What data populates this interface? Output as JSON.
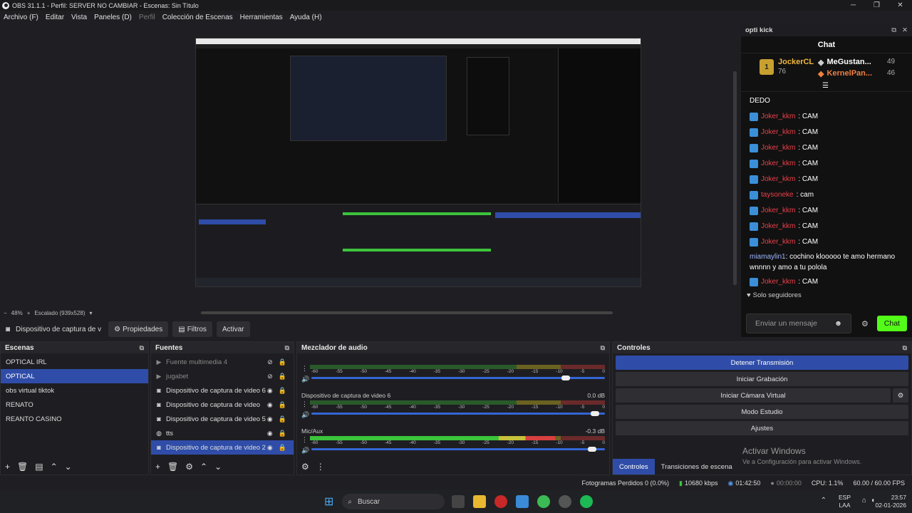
{
  "window": {
    "title": "OBS 31.1.1 - Perfil: SERVER NO CAMBIAR - Escenas: Sin Título",
    "minimize": "─",
    "maximize": "❐",
    "close": "✕"
  },
  "menu": [
    "Archivo (F)",
    "Editar",
    "Vista",
    "Paneles (D)",
    "Perfil",
    "Colección de Escenas",
    "Herramientas",
    "Ayuda (H)"
  ],
  "zoom": {
    "minus": "−",
    "value": "48%",
    "plus": "+",
    "scale": "Escalado (939x528)"
  },
  "source_toolbar": {
    "source_name": "Dispositivo de captura de v",
    "properties": "Propiedades",
    "filters": "Filtros",
    "activate": "Activar"
  },
  "scenes": {
    "title": "Escenas",
    "items": [
      "OPTICAL IRL",
      "OPTICAL",
      "obs virtual tiktok",
      "RENATO",
      "REANTO CASINO"
    ],
    "selected": 1
  },
  "sources": {
    "title": "Fuentes",
    "items": [
      {
        "name": "Fuente multimedia 4",
        "icon": "play-icon",
        "dim": true
      },
      {
        "name": "jugabet",
        "icon": "play-icon",
        "dim": true
      },
      {
        "name": "Dispositivo de captura de video 6",
        "icon": "camera-icon"
      },
      {
        "name": "Dispositivo de captura de video",
        "icon": "camera-icon"
      },
      {
        "name": "Dispositivo de captura de video 5",
        "icon": "camera-icon"
      },
      {
        "name": "tts",
        "icon": "globe-icon"
      },
      {
        "name": "Dispositivo de captura de video 2",
        "icon": "camera-icon",
        "selected": true
      }
    ]
  },
  "mixer": {
    "title": "Mezclador de audio",
    "ticks": [
      "-60",
      "-55",
      "-50",
      "-45",
      "-40",
      "-35",
      "-30",
      "-25",
      "-20",
      "-15",
      "-10",
      "-5",
      "0"
    ],
    "channels": [
      {
        "name": "",
        "db": "",
        "level": 0.0,
        "fader": 0.88
      },
      {
        "name": "Dispositivo de captura de video 6",
        "db": "0.0 dB",
        "level": 0.0,
        "fader": 0.98
      },
      {
        "name": "Mic/Aux",
        "db": "-0.3 dB",
        "level": 0.83,
        "fader": 0.97
      }
    ]
  },
  "controls": {
    "title": "Controles",
    "buttons": [
      "Detener Transmisión",
      "Iniciar Grabación",
      "Iniciar Cámara Virtual",
      "Modo Estudio",
      "Ajustes"
    ],
    "tabs": [
      "Controles",
      "Transiciones de escena"
    ]
  },
  "watermark": {
    "title": "Activar Windows",
    "sub": "Ve a Configuración para activar Windows."
  },
  "chat": {
    "dock_title": "opti kick",
    "header": "Chat",
    "leader1": {
      "name": "JockerCL",
      "count": "76"
    },
    "leader2": {
      "name": "MeGustan...",
      "count": "49"
    },
    "leader3": {
      "name": "KernelPan...",
      "count": "46"
    },
    "pinned": "DEDO",
    "messages": [
      {
        "user": "Joker_kkm",
        "text": ": CAM"
      },
      {
        "user": "Joker_kkm",
        "text": ": CAM"
      },
      {
        "user": "Joker_kkm",
        "text": ": CAM"
      },
      {
        "user": "Joker_kkm",
        "text": ": CAM"
      },
      {
        "user": "Joker_kkm",
        "text": ": CAM"
      },
      {
        "user": "taysoneke",
        "text": ": cam"
      },
      {
        "user": "Joker_kkm",
        "text": ": CAM"
      },
      {
        "user": "Joker_kkm",
        "text": ": CAM"
      },
      {
        "user": "Joker_kkm",
        "text": ": CAM"
      }
    ],
    "long_msg": {
      "user": "miamaylin1",
      "text": ": cochino klooooo te amo hermano wnnnn y amo a tu polola"
    },
    "last_msg": {
      "user": "Joker_kkm",
      "text": ": CAM"
    },
    "followers_only": "Solo seguidores",
    "input_placeholder": "Enviar un mensaje",
    "send": "Chat"
  },
  "status": {
    "dropped": "Fotogramas Perdidos 0 (0.0%)",
    "bitrate": "10680 kbps",
    "stream_time": "01:42:50",
    "rec_time": "00:00:00",
    "cpu": "CPU: 1.1%",
    "fps": "60.00 / 60.00 FPS"
  },
  "taskbar": {
    "search": "Buscar",
    "lang": "ESP",
    "lang2": "LAA",
    "time": "23:57",
    "date": "02-01-2026"
  },
  "colors": {
    "accent": "#2f4da8",
    "kick_green": "#53fc18"
  }
}
